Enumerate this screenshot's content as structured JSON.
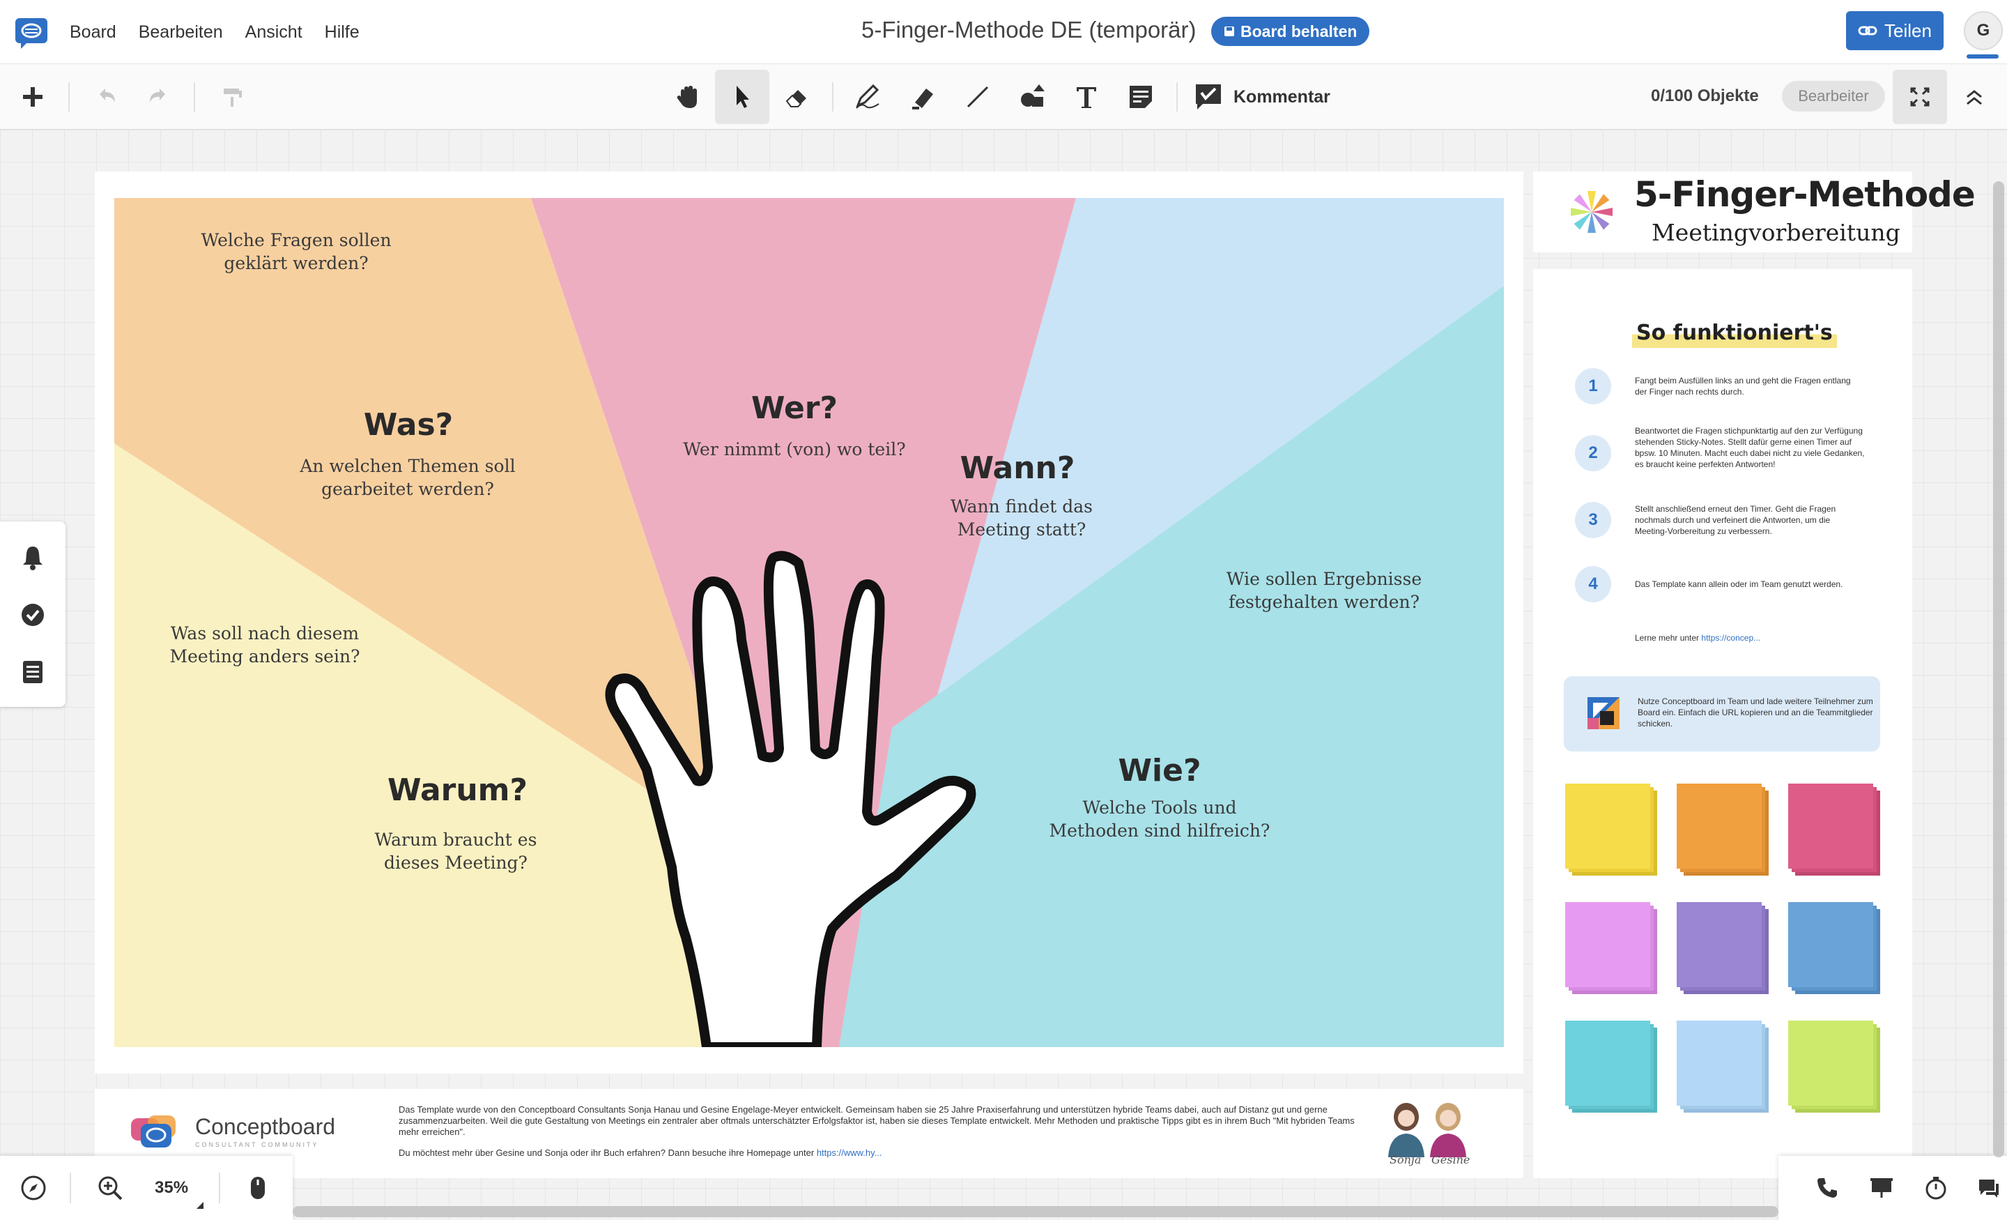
{
  "app": {
    "menu": [
      "Board",
      "Bearbeiten",
      "Ansicht",
      "Hilfe"
    ],
    "board_title": "5-Finger-Methode DE (temporär)",
    "keep_board_label": "Board behalten",
    "share_label": "Teilen",
    "user_initial": "G",
    "brand_color": "#2f70c4"
  },
  "toolbar": {
    "comment_label": "Kommentar",
    "objects_count": "0/100 Objekte",
    "role_label": "Bearbeiter",
    "tools": [
      "add-icon",
      "undo-icon",
      "redo-icon",
      "format-painter-icon",
      "hand-icon",
      "select-arrow-icon",
      "eraser-icon",
      "pen-icon",
      "highlighter-icon",
      "line-icon",
      "shapes-icon",
      "text-icon",
      "sticky-note-icon",
      "comment-icon",
      "fit-screen-icon",
      "collapse-icon"
    ]
  },
  "board": {
    "sections": {
      "top_left_question": "Welche Fragen sollen\ngeklärt werden?",
      "was_heading": "Was?",
      "was_question": "An welchen Themen soll\ngearbeitet werden?",
      "wer_heading": "Wer?",
      "wer_question": "Wer nimmt (von) wo teil?",
      "wann_heading": "Wann?",
      "wann_question": "Wann findet das\nMeeting statt?",
      "right_question": "Wie sollen Ergebnisse\nfestgehalten werden?",
      "left_question": "Was soll nach diesem\nMeeting anders sein?",
      "warum_heading": "Warum?",
      "warum_question": "Warum braucht es\ndieses Meeting?",
      "wie_heading": "Wie?",
      "wie_question": "Welche Tools und\nMethoden sind hilfreich?"
    },
    "colors": {
      "orange": "#f7d0a0",
      "pink": "#eeaec2",
      "lightblue": "#c9e4f6",
      "teal": "#a8e1e8",
      "yellow": "#faf1c2"
    }
  },
  "footer": {
    "brand_name": "Conceptboard",
    "brand_sub": "CONSULTANT COMMUNITY",
    "text": "Das Template wurde von den Conceptboard Consultants Sonja Hanau und Gesine Engelage-Meyer entwickelt. Gemeinsam haben sie 25 Jahre Praxiserfahrung und unterstützen hybride Teams dabei, auch auf Distanz gut und gerne zusammenzuarbeiten. Weil die gute Gestaltung von Meetings ein zentraler aber oftmals unterschätzter Erfolgsfaktor ist, haben sie dieses Template entwickelt. Mehr Methoden und praktische Tipps gibt es in ihrem Buch \"Mit hybriden Teams mehr erreichen\".",
    "text2": "Du möchtest mehr über Gesine und Sonja oder ihr Buch erfahren? Dann besuche ihre Homepage unter",
    "link": "https://www.hy...",
    "sig1": "Sonja",
    "sig2": "Gesine"
  },
  "panel": {
    "title": "5-Finger-Methode",
    "subtitle": "Meetingvorbereitung",
    "howto_title": "So funktioniert's",
    "steps": [
      {
        "num": "1",
        "text": "Fangt beim Ausfüllen links an und geht die Fragen entlang der Finger nach rechts durch."
      },
      {
        "num": "2",
        "text": "Beantwortet die Fragen stichpunktartig auf den zur Verfügung stehenden Sticky-Notes. Stellt dafür gerne einen Timer auf bpsw. 10 Minuten. Macht euch dabei nicht zu viele Gedanken, es braucht keine perfekten Antworten!"
      },
      {
        "num": "3",
        "text": "Stellt anschließend erneut den Timer. Geht die Fragen nochmals durch und verfeinert die Antworten, um die Meeting-Vorbereitung zu verbessern."
      },
      {
        "num": "4",
        "text": "Das Template kann allein oder im Team genutzt werden."
      }
    ],
    "learn_more": "Lerne mehr unter",
    "learn_more_link": "https://concep...",
    "team_text": "Nutze Conceptboard im Team und lade weitere Teilnehmer zum Board ein. Einfach die URL kopieren und an die Teammitglieder schicken.",
    "sticky_colors": [
      "#f7dc4a",
      "#f0a03e",
      "#de5c88",
      "#e79af2",
      "#9b86d4",
      "#6aa3d8",
      "#6dd2dd",
      "#b2d7f7",
      "#cdea6c"
    ]
  },
  "status": {
    "zoom": "35%"
  }
}
